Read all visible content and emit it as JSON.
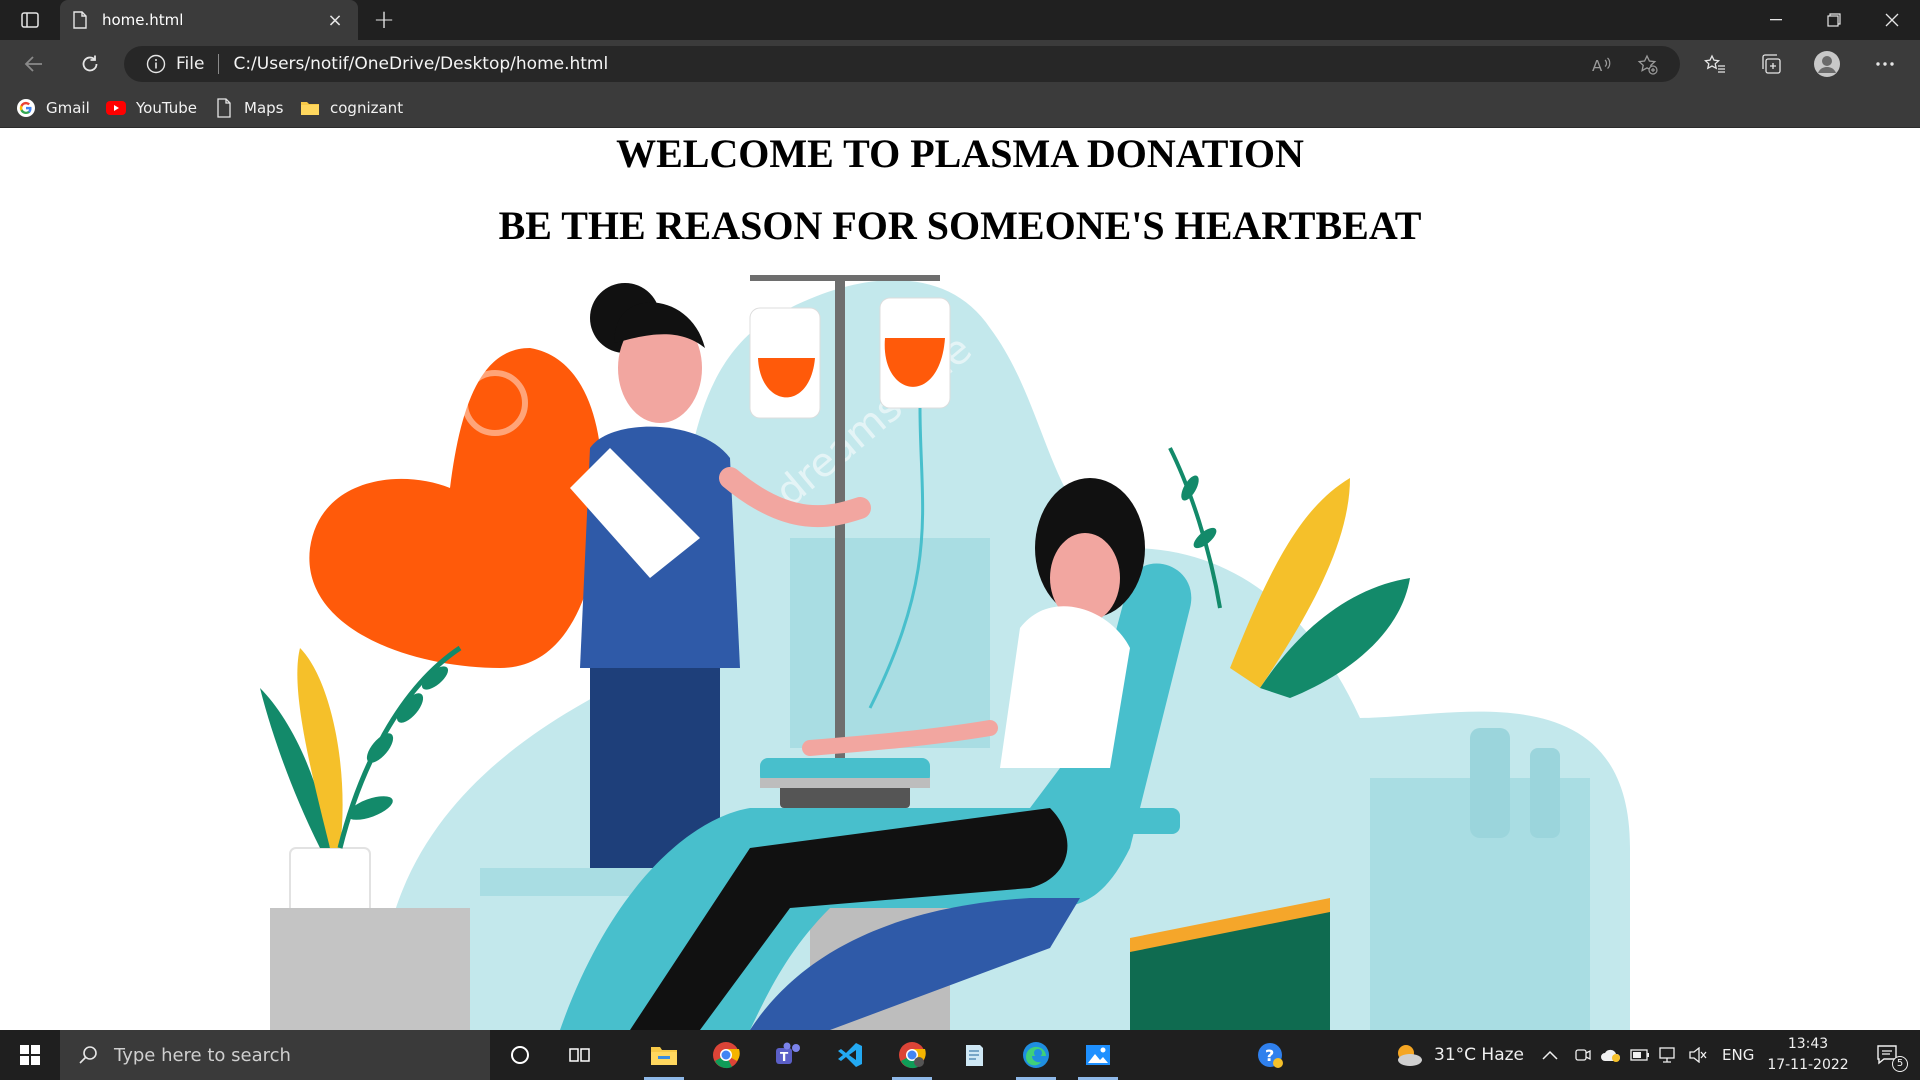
{
  "browser": {
    "tab_title": "home.html",
    "tab_close": "×",
    "new_tab": "+",
    "address_scheme": "File",
    "address_url": "C:/Users/notif/OneDrive/Desktop/home.html",
    "read_aloud_label": "Aᴬ",
    "bookmarks": [
      {
        "label": "Gmail",
        "icon": "google-icon"
      },
      {
        "label": "YouTube",
        "icon": "youtube-icon"
      },
      {
        "label": "Maps",
        "icon": "page-icon"
      },
      {
        "label": "cognizant",
        "icon": "folder-icon"
      }
    ]
  },
  "page": {
    "heading": "WELCOME TO PLASMA DONATION",
    "subheading": "BE THE REASON FOR SOMEONE'S HEARTBEAT",
    "hero_watermark": "dreamstime"
  },
  "taskbar": {
    "search_placeholder": "Type here to search",
    "weather": "31°C  Haze",
    "language": "ENG",
    "time": "13:43",
    "date": "17-11-2022",
    "notifications_count": "5"
  },
  "colors": {
    "heart": "#ff5a0a",
    "teal_light": "#bfe6ea",
    "teal": "#48bfcc",
    "navy_scrubs": "#2f5aa8",
    "leaf_green": "#138a6a",
    "leaf_yellow": "#f5c02a"
  }
}
